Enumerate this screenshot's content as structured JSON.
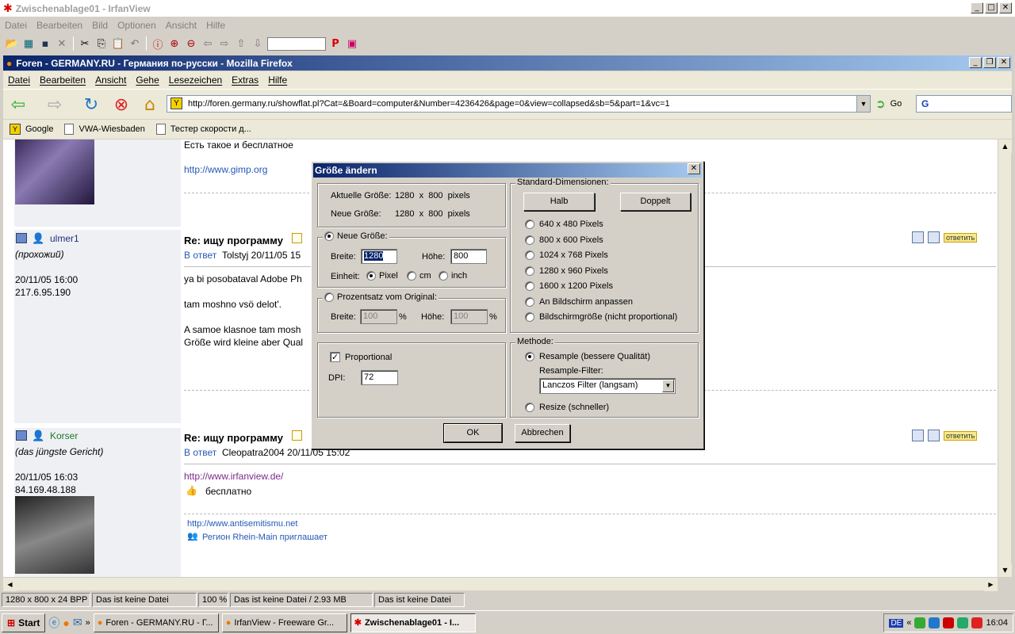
{
  "irfanview": {
    "title": "Zwischenablage01 - IrfanView",
    "menu": [
      "Datei",
      "Bearbeiten",
      "Bild",
      "Optionen",
      "Ansicht",
      "Hilfe"
    ],
    "status": [
      "1280 x 800 x 24 BPP",
      "Das ist keine Datei",
      "100 %",
      "Das ist keine Datei / 2.93 MB",
      "Das ist keine Datei"
    ]
  },
  "firefox": {
    "title": "Foren - GERMANY.RU - Германия по-русски - Mozilla Firefox",
    "menu": [
      "Datei",
      "Bearbeiten",
      "Ansicht",
      "Gehe",
      "Lesezeichen",
      "Extras",
      "Hilfe"
    ],
    "url": "http://foren.germany.ru/showflat.pl?Cat=&Board=computer&Number=4236426&page=0&view=collapsed&sb=5&part=1&vc=1",
    "go_label": "Go",
    "search_value": "G",
    "bookmarks": [
      "Google",
      "VWA-Wiesbaden",
      "Тестер скорости д..."
    ]
  },
  "page": {
    "top_text": "Есть такое и бесплатное",
    "top_link": "http://www.gimp.org",
    "posts": [
      {
        "user": "ulmer1",
        "role": "(прохожий)",
        "date": "20/11/05 16:00",
        "ip": "217.6.95.190",
        "subject": "Re: ищу программу",
        "reply_prefix": "В ответ",
        "reply_info": "Tolstyj 20/11/05 15",
        "lines": [
          "ya bi posobataval Adobe Ph",
          "tam moshno vsö delot'.",
          "A samoe klasnoe tam mosh",
          "Größe wird kleine aber Qual"
        ],
        "reply_btn": "ответить"
      },
      {
        "user": "Korser",
        "role": "(das jüngste Gericht)",
        "date": "20/11/05 16:03",
        "ip": "84.169.48.188",
        "subject": "Re: ищу программу",
        "reply_prefix": "В ответ",
        "reply_info": "Cleopatra2004 20/11/05 15:02",
        "link": "http://www.irfanview.de/",
        "text": "бесплатно",
        "sig_link": "http://www.antisemitismu.net",
        "sig_text": "Регион Rhein-Main приглашает",
        "reply_btn": "ответить"
      }
    ]
  },
  "dialog": {
    "title": "Größe ändern",
    "current_label": "Aktuelle Größe:",
    "current_value": "1280  x  800  pixels",
    "new_label": "Neue Größe:",
    "new_value": "1280  x  800  pixels",
    "new_size_group": "Neue Größe:",
    "width_label": "Breite:",
    "width_value": "1280",
    "height_label": "Höhe:",
    "height_value": "800",
    "unit_label": "Einheit:",
    "units": [
      "Pixel",
      "cm",
      "inch"
    ],
    "percent_group": "Prozentsatz vom Original:",
    "pct_width_label": "Breite:",
    "pct_width_value": "100",
    "pct_height_label": "Höhe:",
    "pct_height_value": "100",
    "pct_sign": "%",
    "proportional_label": "Proportional",
    "dpi_label": "DPI:",
    "dpi_value": "72",
    "std_group": "Standard-Dimensionen:",
    "half_btn": "Halb",
    "double_btn": "Doppelt",
    "std_options": [
      "640 x 480 Pixels",
      "800 x 600 Pixels",
      "1024 x 768 Pixels",
      "1280 x 960 Pixels",
      "1600 x 1200 Pixels",
      "An Bildschirm anpassen",
      "Bildschirmgröße (nicht proportional)"
    ],
    "method_group": "Methode:",
    "resample_label": "Resample (bessere Qualität)",
    "filter_label": "Resample-Filter:",
    "filter_value": "Lanczos Filter (langsam)",
    "resize_label": "Resize (schneller)",
    "ok_btn": "OK",
    "cancel_btn": "Abbrechen"
  },
  "taskbar": {
    "start": "Start",
    "tasks": [
      "Foren - GERMANY.RU - Г...",
      "IrfanView - Freeware Gr...",
      "Zwischenablage01 - I..."
    ],
    "lang": "DE",
    "time": "16:04"
  }
}
